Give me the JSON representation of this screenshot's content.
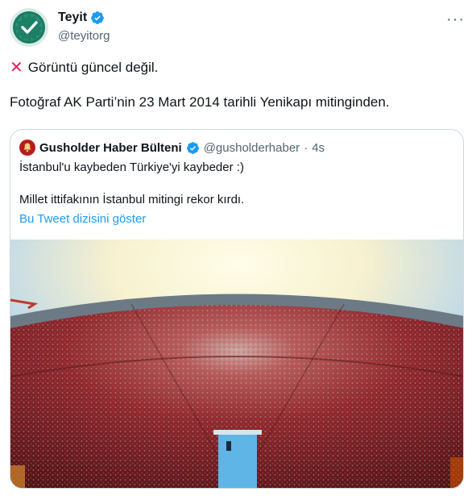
{
  "author": {
    "display_name": "Teyit",
    "handle": "@teyitorg"
  },
  "tweet": {
    "status_text": "Görüntü güncel değil.",
    "body_text": "Fotoğraf AK Parti’nin 23 Mart 2014 tarihli Yenikapı mitinginden."
  },
  "quoted_tweet": {
    "display_name": "Gusholder Haber Bülteni",
    "handle": "@gusholderhaber",
    "separator": "·",
    "time": "4s",
    "text_line1": "İstanbul'u kaybeden Türkiye'yi kaybeder :)",
    "text_line2": "Millet ittifakının İstanbul mitingi rekor kırdı.",
    "show_thread_link": "Bu Tweet dizisini göster"
  },
  "icons": {
    "verified": "verified-badge-icon",
    "more": "more-options-icon",
    "status": "red-x-icon"
  },
  "colors": {
    "verified_blue": "#1d9bf0",
    "link_blue": "#1d9bf0",
    "x_red": "#e0245e",
    "secondary_text": "#536471",
    "crowd_red": "#b3262e"
  }
}
